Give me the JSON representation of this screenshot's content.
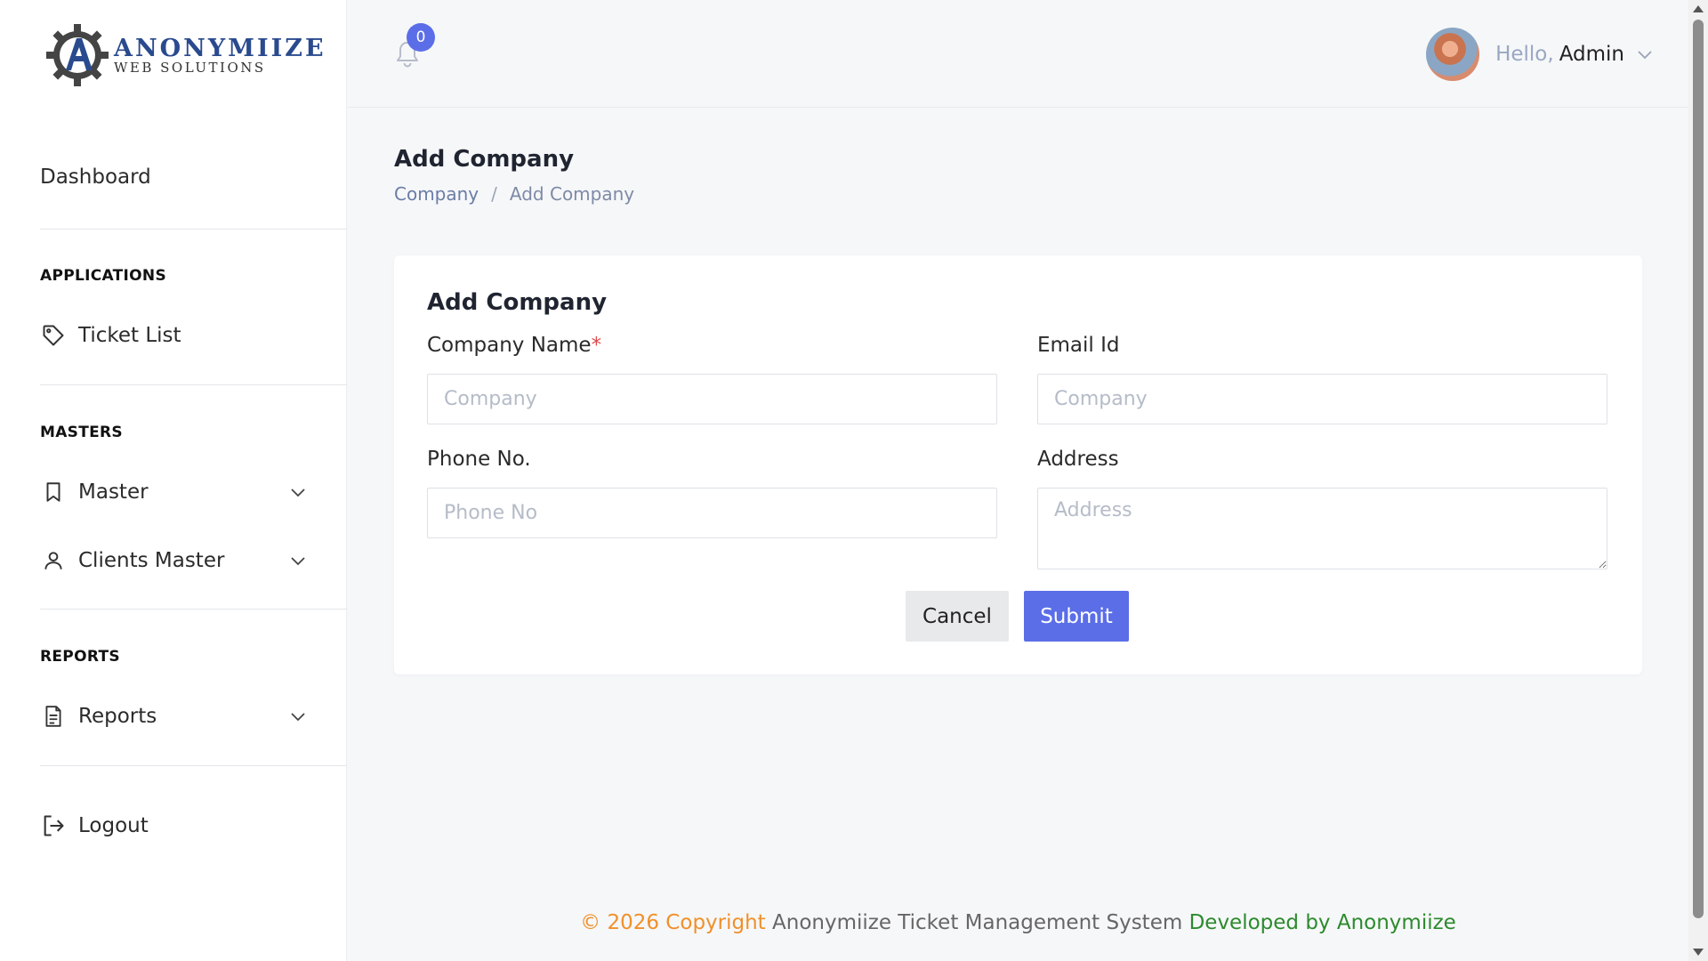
{
  "brand": {
    "name": "ANONYMIIZE",
    "tagline": "WEB SOLUTIONS",
    "accent_color": "#2a4a8e"
  },
  "sidebar": {
    "dashboard": "Dashboard",
    "sections": {
      "applications": "APPLICATIONS",
      "masters": "MASTERS",
      "reports": "REPORTS"
    },
    "items": {
      "ticket_list": {
        "label": "Ticket List",
        "icon": "tag-icon"
      },
      "master": {
        "label": "Master",
        "icon": "bookmark-icon"
      },
      "clients_master": {
        "label": "Clients Master",
        "icon": "user-icon"
      },
      "reports": {
        "label": "Reports",
        "icon": "document-icon"
      },
      "logout": {
        "label": "Logout",
        "icon": "logout-icon"
      }
    }
  },
  "header": {
    "notification_count": "0",
    "greeting": "Hello,",
    "user_name": "Admin"
  },
  "page": {
    "title": "Add Company",
    "breadcrumb": {
      "parent": "Company",
      "separator": "/",
      "current": "Add Company"
    }
  },
  "form": {
    "title": "Add Company",
    "company_name": {
      "label": "Company Name",
      "required_mark": "*",
      "placeholder": "Company"
    },
    "email": {
      "label": "Email Id",
      "placeholder": "Company"
    },
    "phone": {
      "label": "Phone No.",
      "placeholder": "Phone No"
    },
    "address": {
      "label": "Address",
      "placeholder": "Address"
    },
    "cancel_label": "Cancel",
    "submit_label": "Submit",
    "primary_color": "#5b6ee8"
  },
  "footer": {
    "copyright": "© 2026 Copyright",
    "system": "Anonymiize Ticket Management System",
    "developer": "Developed by Anonymiize"
  }
}
